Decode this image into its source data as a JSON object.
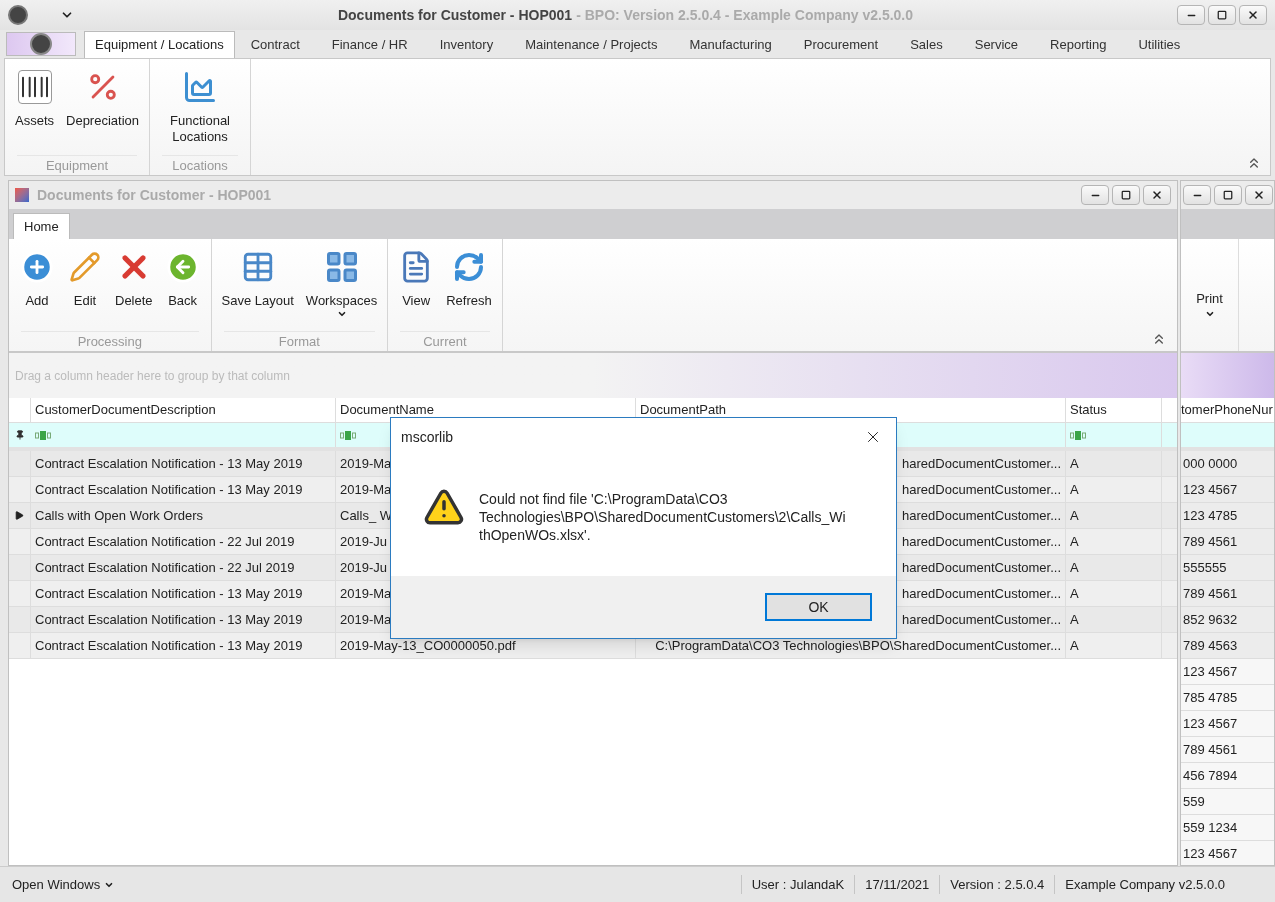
{
  "app": {
    "title": "Documents for Customer - HOP001",
    "subtitle": "- BPO: Version 2.5.0.4 - Example Company v2.5.0.0"
  },
  "ribbon": {
    "tabs": [
      {
        "label": "Equipment / Locations",
        "selected": true
      },
      {
        "label": "Contract",
        "selected": false
      },
      {
        "label": "Finance / HR",
        "selected": false
      },
      {
        "label": "Inventory",
        "selected": false
      },
      {
        "label": "Maintenance / Projects",
        "selected": false
      },
      {
        "label": "Manufacturing",
        "selected": false
      },
      {
        "label": "Procurement",
        "selected": false
      },
      {
        "label": "Sales",
        "selected": false
      },
      {
        "label": "Service",
        "selected": false
      },
      {
        "label": "Reporting",
        "selected": false
      },
      {
        "label": "Utilities",
        "selected": false
      }
    ],
    "groups": [
      {
        "label": "Equipment",
        "items": [
          {
            "label": "Assets",
            "dropdown": false
          },
          {
            "label": "Depreciation",
            "dropdown": false
          }
        ]
      },
      {
        "label": "Locations",
        "items": [
          {
            "label": "Functional Locations",
            "dropdown": false
          }
        ]
      }
    ]
  },
  "child_window": {
    "title": "Documents for Customer - HOP001",
    "tabs": [
      {
        "label": "Home",
        "selected": true
      }
    ],
    "groups": [
      {
        "label": "Processing",
        "items": [
          {
            "label": "Add",
            "dropdown": false
          },
          {
            "label": "Edit",
            "dropdown": false
          },
          {
            "label": "Delete",
            "dropdown": false
          },
          {
            "label": "Back",
            "dropdown": false
          }
        ]
      },
      {
        "label": "Format",
        "items": [
          {
            "label": "Save Layout",
            "dropdown": false
          },
          {
            "label": "Workspaces",
            "dropdown": true
          }
        ]
      },
      {
        "label": "Current",
        "items": [
          {
            "label": "View",
            "dropdown": false
          },
          {
            "label": "Refresh",
            "dropdown": false
          }
        ]
      }
    ],
    "group_panel_hint": "Drag a column header here to group by that column",
    "grid": {
      "columns": [
        "CustomerDocumentDescription",
        "DocumentName",
        "DocumentPath",
        "Status"
      ],
      "rows": [
        {
          "selected": false,
          "cells": [
            "Contract Escalation Notification - 13 May 2019",
            "2019-Ma",
            "haredDocumentCustomer...",
            "A"
          ]
        },
        {
          "selected": false,
          "cells": [
            "Contract Escalation Notification - 13 May 2019",
            "2019-Ma",
            "haredDocumentCustomer...",
            "A"
          ]
        },
        {
          "selected": true,
          "cells": [
            "Calls with Open Work Orders",
            "Calls_ W",
            "haredDocumentCustomer...",
            "A"
          ]
        },
        {
          "selected": false,
          "cells": [
            "Contract Escalation Notification - 22 Jul 2019",
            "2019-Ju",
            "haredDocumentCustomer...",
            "A"
          ]
        },
        {
          "selected": false,
          "cells": [
            "Contract Escalation Notification - 22 Jul 2019",
            "2019-Ju",
            "haredDocumentCustomer...",
            "A"
          ]
        },
        {
          "selected": false,
          "cells": [
            "Contract Escalation Notification - 13 May 2019",
            "2019-Ma",
            "haredDocumentCustomer...",
            "A"
          ]
        },
        {
          "selected": false,
          "cells": [
            "Contract Escalation Notification - 13 May 2019",
            "2019-Ma",
            "haredDocumentCustomer...",
            "A"
          ]
        },
        {
          "selected": false,
          "cells": [
            "Contract Escalation Notification - 13 May 2019",
            "2019-May-13_CO0000050.pdf",
            "C:\\ProgramData\\CO3 Technologies\\BPO\\SharedDocumentCustomer...",
            "A"
          ]
        }
      ]
    }
  },
  "second_window": {
    "print_button": {
      "label": "Print",
      "dropdown": true
    },
    "column": "tomerPhoneNur",
    "values": [
      "000 0000",
      "123 4567",
      "123 4785",
      "789 4561",
      "555555",
      "789 4561",
      "852 9632",
      "789 4563",
      "123 4567",
      "785 4785",
      "123 4567",
      "789 4561",
      "456 7894",
      "559",
      "559 1234",
      "123 4567"
    ]
  },
  "dialog": {
    "title": "mscorlib",
    "message": "Could not find file 'C:\\ProgramData\\CO3 Technologies\\BPO\\SharedDocumentCustomers\\2\\Calls_WithOpenWOs.xlsx'.",
    "ok_button": "OK"
  },
  "status_bar": {
    "open_windows": "Open Windows",
    "items": [
      "User : JulandaK",
      "17/11/2021",
      "Version : 2.5.0.4",
      "Example Company v2.5.0.0"
    ]
  }
}
